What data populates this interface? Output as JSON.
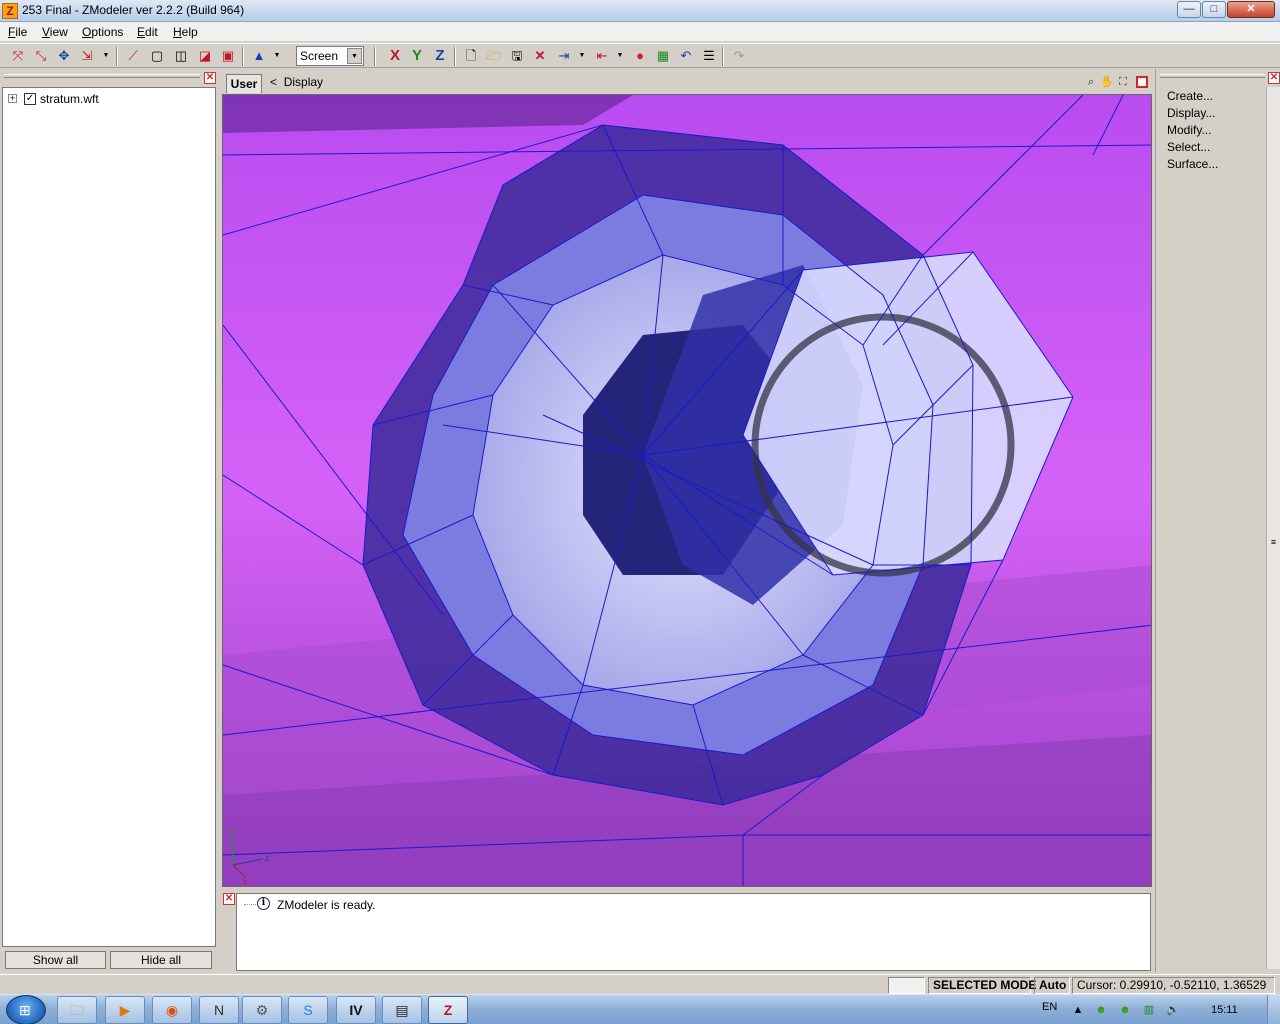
{
  "window": {
    "title": "253 Final - ZModeler ver 2.2.2 (Build 964)",
    "app_icon_letter": "Z",
    "minimize_glyph": "—",
    "maximize_glyph": "□",
    "close_glyph": "✕"
  },
  "menu": {
    "items": [
      {
        "label": "File",
        "underline": "F",
        "rest": "ile"
      },
      {
        "label": "View",
        "underline": "V",
        "rest": "iew"
      },
      {
        "label": "Options",
        "underline": "O",
        "rest": "ptions"
      },
      {
        "label": "Edit",
        "underline": "E",
        "rest": "dit"
      },
      {
        "label": "Help",
        "underline": "H",
        "rest": "elp"
      }
    ]
  },
  "toolbar": {
    "view_mode": "Screen",
    "axis_x": "X",
    "axis_y": "Y",
    "axis_z": "Z",
    "icons": [
      "select-vertex-icon",
      "select-point-icon",
      "move-icon",
      "scale-icon",
      "snap-icon",
      "cube-wire-icon",
      "cube-solid-icon",
      "cube-shaded-icon",
      "cube-textured-icon",
      "light-icon",
      "new-file-icon",
      "open-file-icon",
      "save-file-icon",
      "delete-icon",
      "import-icon",
      "export-icon",
      "render-icon",
      "texture-icon",
      "undo-icon",
      "notes-icon",
      "redo-icon"
    ],
    "accent_color": "#c0152a"
  },
  "left_panel": {
    "tree_item": "stratum.wft",
    "tree_checked": "✓",
    "tree_expand": "+",
    "show_all": "Show all",
    "hide_all": "Hide all"
  },
  "viewport": {
    "tab_label": "User",
    "back_glyph": "<",
    "display_label": "Display",
    "background_color": "#c456f5",
    "wire_color": "#1a1acc"
  },
  "log": {
    "info_glyph": "i",
    "message": "ZModeler is ready."
  },
  "right_panel": {
    "commands": [
      "Create...",
      "Display...",
      "Modify...",
      "Select...",
      "Surface..."
    ]
  },
  "status": {
    "mode": "SELECTED MODE",
    "auto": "Auto",
    "cursor": "Cursor: 0.29910, -0.52110, 1.36529"
  },
  "taskbar": {
    "apps": [
      "explorer-icon",
      "media-player-icon",
      "firefox-icon",
      "notepad-icon",
      "wrench-icon",
      "skype-icon",
      "gta-iv-icon",
      "console-icon",
      "zmodeler-icon"
    ],
    "lang": "EN",
    "clock": "15:11"
  }
}
